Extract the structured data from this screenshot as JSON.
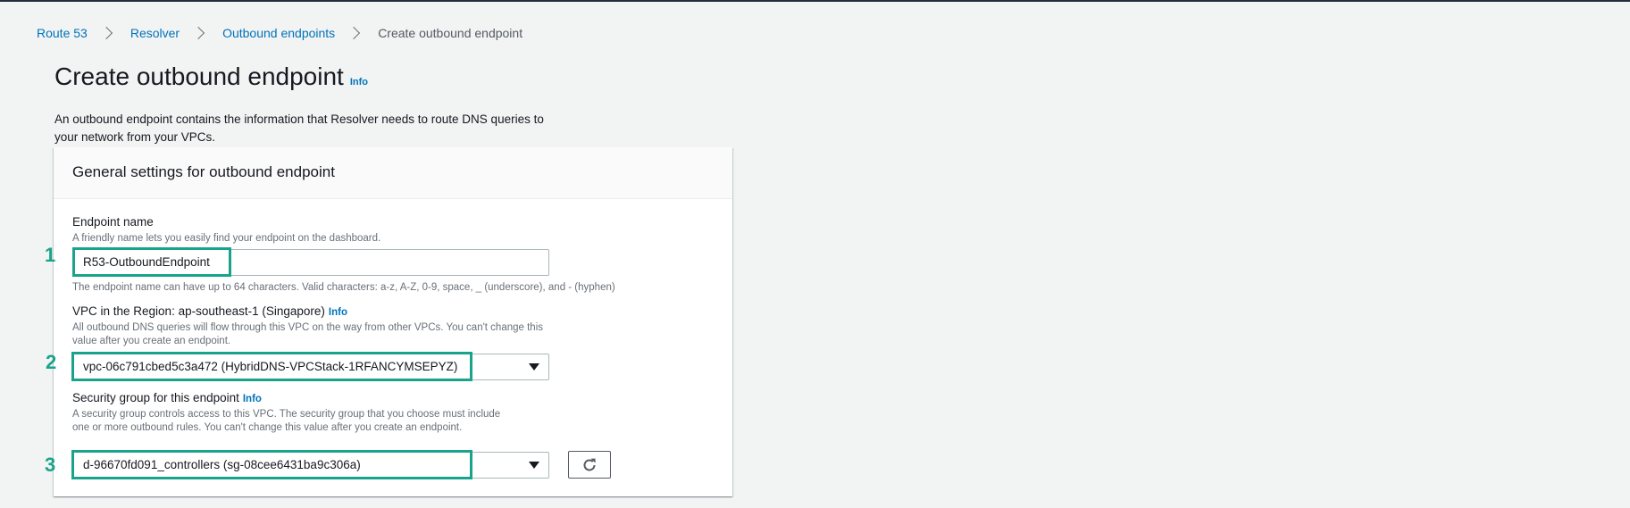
{
  "breadcrumb": {
    "items": [
      "Route 53",
      "Resolver",
      "Outbound endpoints"
    ],
    "current": "Create outbound endpoint"
  },
  "page": {
    "title": "Create outbound endpoint",
    "info": "Info",
    "description": "An outbound endpoint contains the information that Resolver needs to route DNS queries to your network from your VPCs."
  },
  "panel": {
    "title": "General settings for outbound endpoint"
  },
  "endpoint_name": {
    "label": "Endpoint name",
    "description": "A friendly name lets you easily find your endpoint on the dashboard.",
    "value": "R53-OutboundEndpoint",
    "constraint": "The endpoint name can have up to 64 characters. Valid characters: a-z, A-Z, 0-9, space, _ (underscore), and - (hyphen)",
    "step": "1"
  },
  "vpc": {
    "label": "VPC in the Region: ap-southeast-1 (Singapore)",
    "info": "Info",
    "description": "All outbound DNS queries will flow through this VPC on the way from other VPCs. You can't change this value after you create an endpoint.",
    "value": "vpc-06c791cbed5c3a472 (HybridDNS-VPCStack-1RFANCYMSEPYZ)",
    "step": "2"
  },
  "security_group": {
    "label": "Security group for this endpoint",
    "info": "Info",
    "description": "A security group controls access to this VPC. The security group that you choose must include one or more outbound rules. You can't change this value after you create an endpoint.",
    "value": "d-96670fd091_controllers (sg-08cee6431ba9c306a)",
    "step": "3"
  },
  "icons": {
    "separator": "chevron-right-icon",
    "dropdown": "caret-down-icon",
    "refresh": "refresh-icon"
  },
  "colors": {
    "link": "#0073bb",
    "highlight": "#1aa38c",
    "background": "#f2f3f3"
  }
}
